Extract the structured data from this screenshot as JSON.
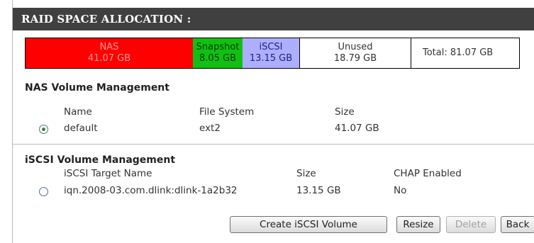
{
  "header": {
    "title": "RAID SPACE ALLOCATION :"
  },
  "allocation": {
    "segments": [
      {
        "label": "NAS",
        "value": "41.07 GB",
        "color": "#ff0000"
      },
      {
        "label": "Snapshot",
        "value": "8.05 GB",
        "color": "#11c011"
      },
      {
        "label": "iSCSI",
        "value": "13.15 GB",
        "color": "#aeaeff"
      },
      {
        "label": "Unused",
        "value": "18.79 GB",
        "color": "#ffffff"
      }
    ],
    "total": "Total: 81.07 GB"
  },
  "nas": {
    "title": "NAS Volume Management",
    "columns": [
      "Name",
      "File System",
      "Size"
    ],
    "rows": [
      {
        "name": "default",
        "file_system": "ext2",
        "size": "41.07 GB",
        "selected": true
      }
    ]
  },
  "iscsi": {
    "title": "iSCSI Volume Management",
    "columns": [
      "iSCSI Target Name",
      "Size",
      "CHAP Enabled"
    ],
    "rows": [
      {
        "target_name": "iqn.2008-03.com.dlink:dlink-1a2b32",
        "size": "13.15 GB",
        "chap": "No",
        "selected": false
      }
    ]
  },
  "buttons": {
    "create_iscsi": "Create iSCSI Volume",
    "resize": "Resize",
    "delete": "Delete",
    "back": "Back"
  }
}
